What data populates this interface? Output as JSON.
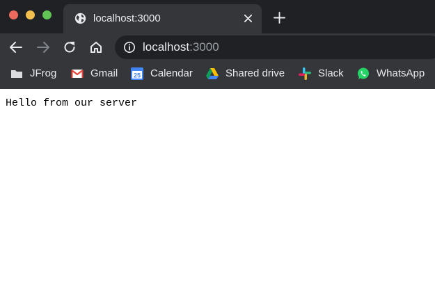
{
  "window": {
    "controls": [
      "close",
      "minimize",
      "zoom"
    ]
  },
  "tab": {
    "title": "localhost:3000",
    "icon": "globe-icon",
    "close_icon": "close-icon"
  },
  "toolbar": {
    "icons": [
      "back-arrow-icon",
      "forward-arrow-icon",
      "reload-icon",
      "home-icon"
    ],
    "url_host": "localhost",
    "url_port": ":3000",
    "info_icon": "info-icon"
  },
  "bookmarks": [
    {
      "label": "JFrog",
      "icon": "folder-icon"
    },
    {
      "label": "Gmail",
      "icon": "gmail-icon"
    },
    {
      "label": "Calendar",
      "icon": "calendar-icon",
      "icon_text": "25"
    },
    {
      "label": "Shared drive",
      "icon": "google-drive-icon"
    },
    {
      "label": "Slack",
      "icon": "slack-icon"
    },
    {
      "label": "WhatsApp",
      "icon": "whatsapp-icon"
    }
  ],
  "page": {
    "body_text": "Hello from our server"
  },
  "colors": {
    "tabstrip": "#202124",
    "toolbar": "#35363a",
    "omnibox": "#202124",
    "traffic_red": "#ed6a5e",
    "traffic_yellow": "#f5bf4f",
    "traffic_green": "#61c454"
  }
}
